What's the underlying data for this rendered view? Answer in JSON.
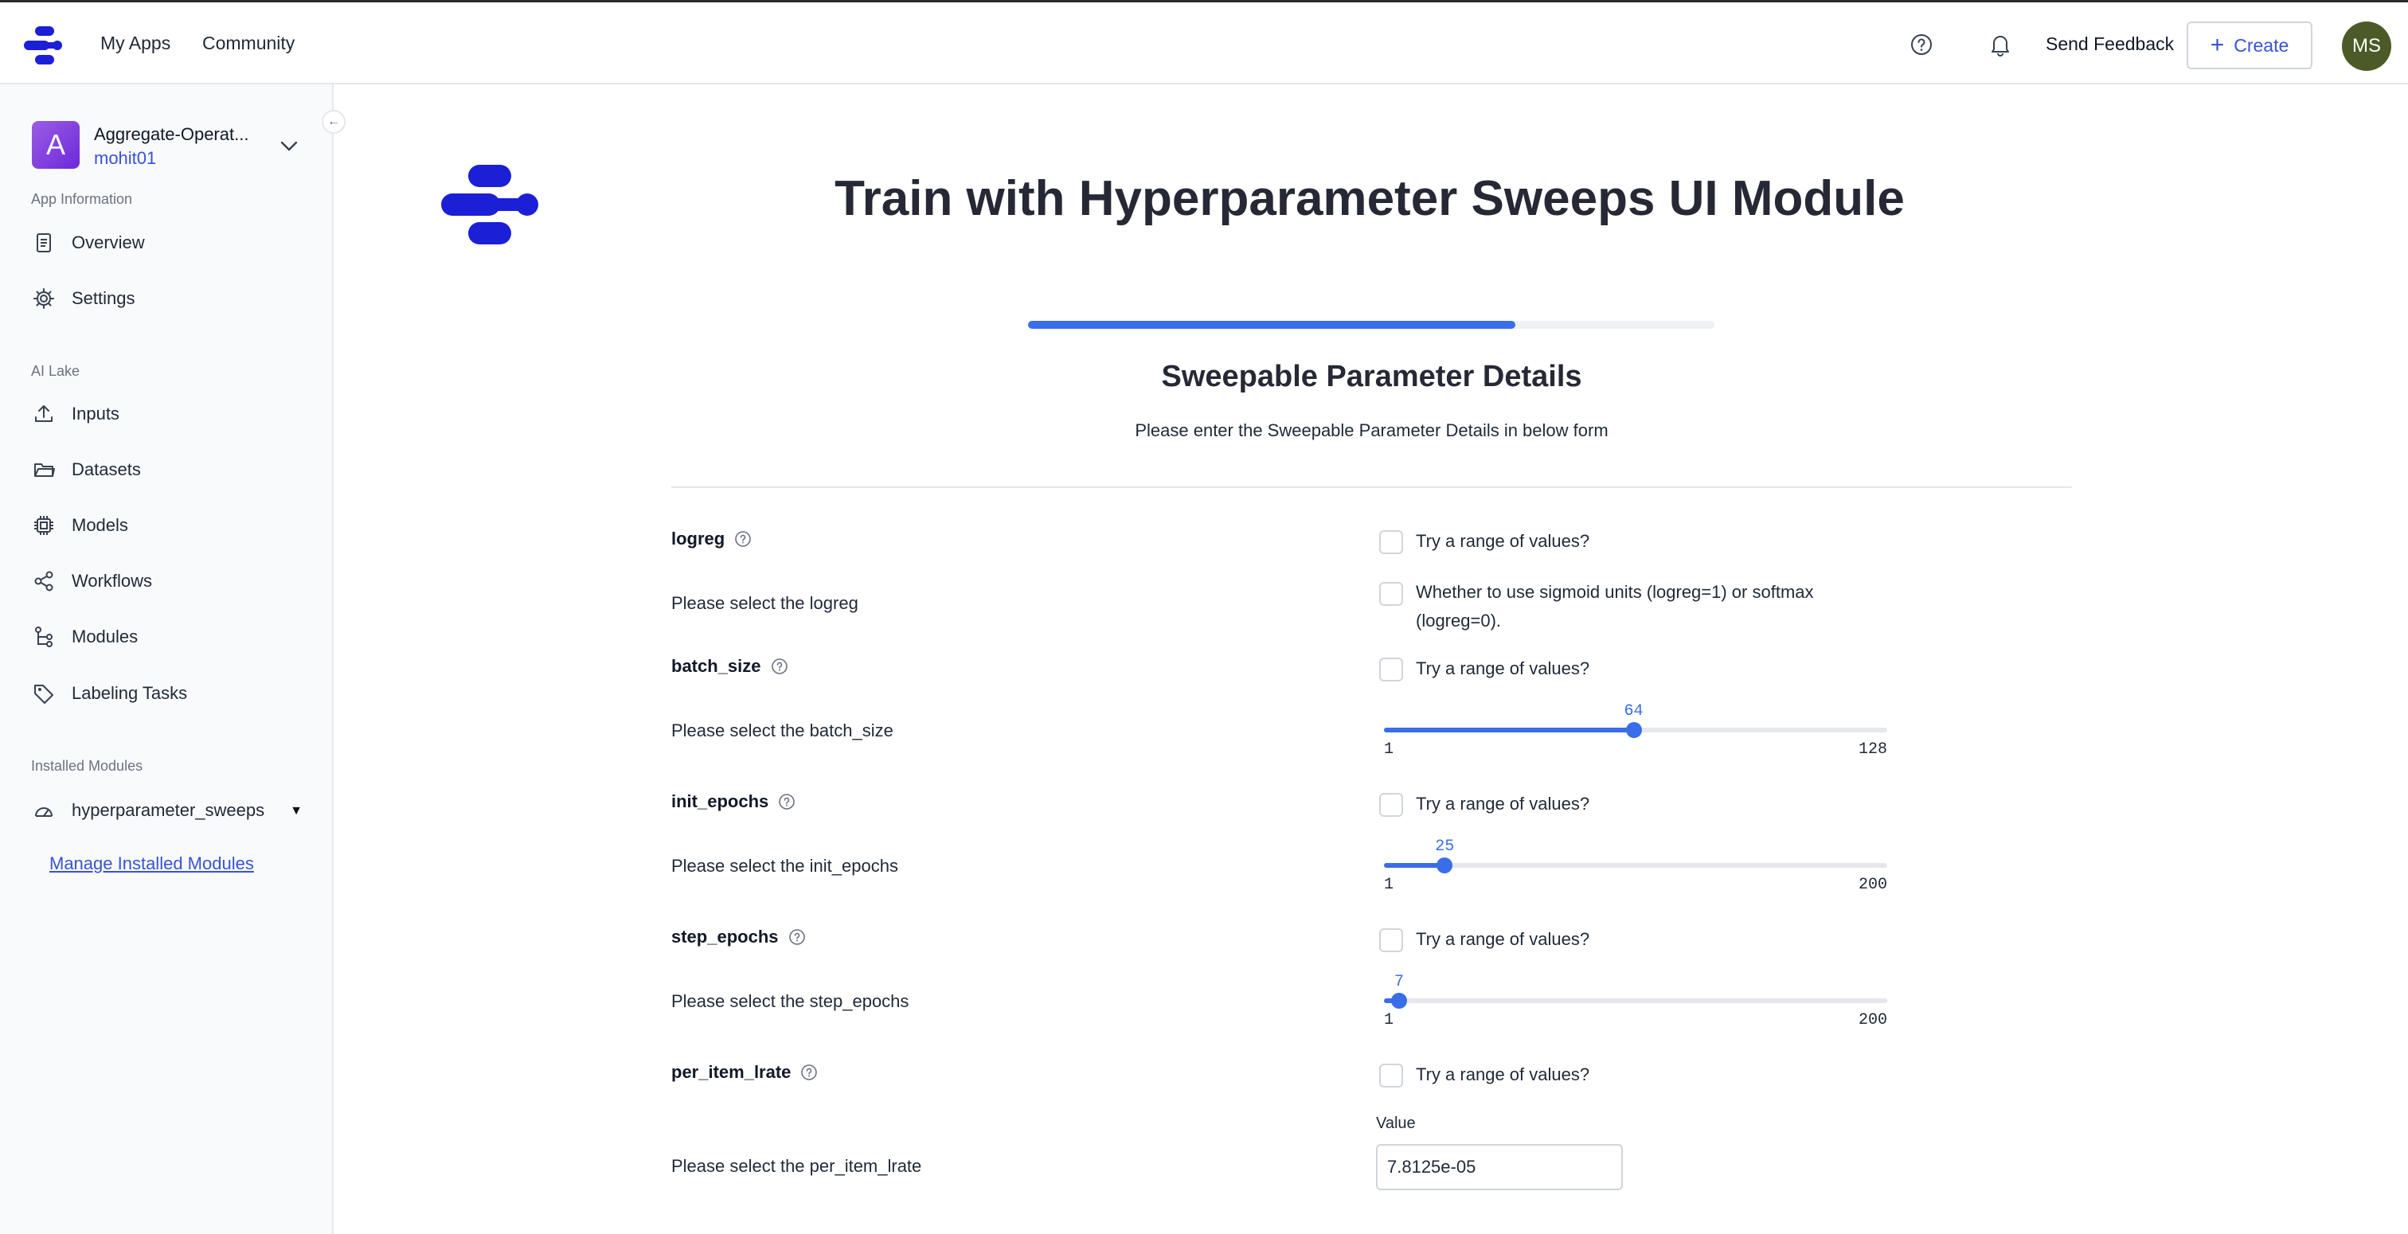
{
  "topnav": {
    "links": [
      "My Apps",
      "Community"
    ],
    "feedback_label": "Send Feedback",
    "create_label": "Create",
    "avatar_initials": "MS"
  },
  "sidebar": {
    "app": {
      "badge": "A",
      "name": "Aggregate-Operat...",
      "owner": "mohit01"
    },
    "sections": [
      {
        "label": "App Information",
        "items": [
          {
            "label": "Overview",
            "icon": "document-icon"
          },
          {
            "label": "Settings",
            "icon": "gear-icon"
          }
        ]
      },
      {
        "label": "AI Lake",
        "items": [
          {
            "label": "Inputs",
            "icon": "upload-icon"
          },
          {
            "label": "Datasets",
            "icon": "folder-icon"
          },
          {
            "label": "Models",
            "icon": "cpu-icon"
          },
          {
            "label": "Workflows",
            "icon": "share-icon"
          },
          {
            "label": "Modules",
            "icon": "modules-icon"
          },
          {
            "label": "Labeling Tasks",
            "icon": "tag-icon"
          }
        ]
      },
      {
        "label": "Installed Modules",
        "items": [
          {
            "label": "hyperparameter_sweeps",
            "icon": "gauge-icon"
          }
        ]
      }
    ],
    "manage_link": "Manage Installed Modules"
  },
  "main": {
    "title": "Train with Hyperparameter Sweeps UI Module",
    "progress_fraction": 0.71,
    "step_title": "Sweepable Parameter Details",
    "step_subtitle": "Please enter the Sweepable Parameter Details in below form",
    "range_label": "Try a range of values?",
    "params": [
      {
        "name": "logreg",
        "prompt": "Please select the logreg",
        "checkbox_label": "Whether to use sigmoid units (logreg=1) or softmax (logreg=0)."
      },
      {
        "name": "batch_size",
        "prompt": "Please select the batch_size",
        "slider": {
          "min": 1,
          "max": 128,
          "value": 64
        }
      },
      {
        "name": "init_epochs",
        "prompt": "Please select the init_epochs",
        "slider": {
          "min": 1,
          "max": 200,
          "value": 25
        }
      },
      {
        "name": "step_epochs",
        "prompt": "Please select the step_epochs",
        "slider": {
          "min": 1,
          "max": 200,
          "value": 7
        }
      },
      {
        "name": "per_item_lrate",
        "prompt": "Please select the per_item_lrate",
        "input_label": "Value",
        "input_value": "7.8125e-05"
      }
    ]
  },
  "colors": {
    "accent": "#3a6ee8",
    "brand": "#1b1fd6",
    "link": "#3653d6",
    "avatar": "#4b5a26"
  }
}
